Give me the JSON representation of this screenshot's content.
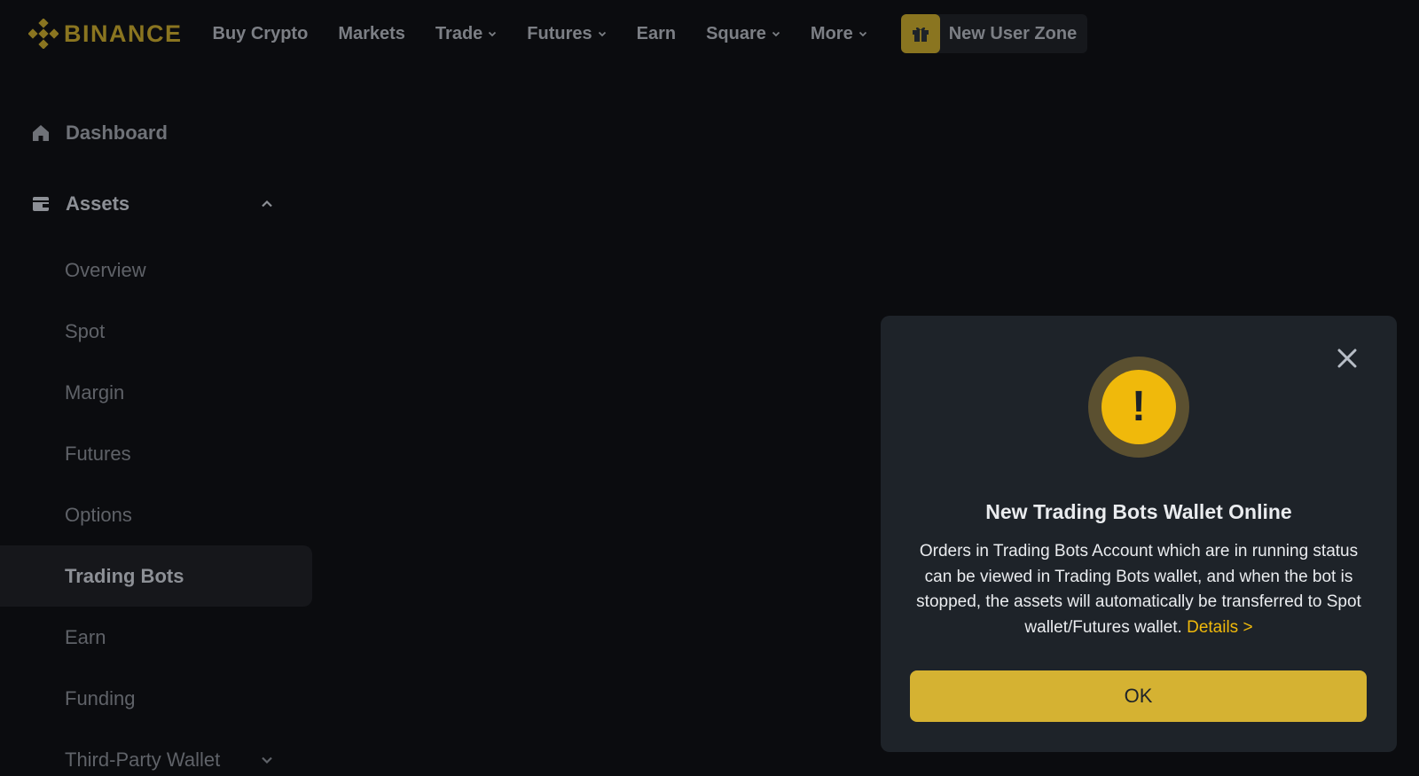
{
  "header": {
    "logo_text": "BINANCE",
    "nav": [
      {
        "label": "Buy Crypto",
        "dropdown": false
      },
      {
        "label": "Markets",
        "dropdown": false
      },
      {
        "label": "Trade",
        "dropdown": true
      },
      {
        "label": "Futures",
        "dropdown": true
      },
      {
        "label": "Earn",
        "dropdown": false
      },
      {
        "label": "Square",
        "dropdown": true
      },
      {
        "label": "More",
        "dropdown": true
      }
    ],
    "new_user_zone": "New User Zone"
  },
  "sidebar": {
    "dashboard": "Dashboard",
    "assets": "Assets",
    "asset_items": [
      {
        "label": "Overview"
      },
      {
        "label": "Spot"
      },
      {
        "label": "Margin"
      },
      {
        "label": "Futures"
      },
      {
        "label": "Options"
      },
      {
        "label": "Trading Bots",
        "active": true
      },
      {
        "label": "Earn"
      },
      {
        "label": "Funding"
      },
      {
        "label": "Third-Party Wallet"
      }
    ]
  },
  "modal": {
    "title": "New Trading Bots Wallet Online",
    "body": "Orders in Trading Bots Account which are in running status can be viewed in Trading Bots wallet, and when the bot is stopped, the assets will automatically be transferred to Spot wallet/Futures wallet.",
    "details_link": "Details >",
    "ok_label": "OK",
    "warning_symbol": "!"
  },
  "colors": {
    "brand_yellow": "#f0b90b",
    "modal_bg": "#1e2329",
    "page_bg": "#0b0c0f",
    "ok_button": "#d5b232"
  },
  "icons": {
    "logo": "binance-logo-icon",
    "gift": "gift-icon",
    "home": "home-icon",
    "wallet": "wallet-icon",
    "close": "close-icon",
    "warning": "warning-icon"
  }
}
